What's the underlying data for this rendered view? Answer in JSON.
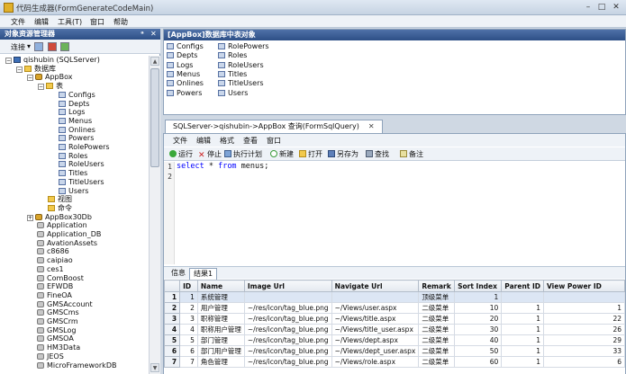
{
  "window": {
    "title": "代码生成器(FormGenerateCodeMain)",
    "minimize": "–",
    "maximize": "□",
    "close": "✕"
  },
  "menu": [
    "文件",
    "编辑",
    "工具(T)",
    "窗口",
    "帮助"
  ],
  "left_panel": {
    "title": "对象资源管理器",
    "pin": "ᵃ",
    "close": "✕",
    "toolbar": {
      "connect_label": "连接",
      "dropdown": "▾"
    },
    "tree": [
      {
        "label": "qishubin (SQLServer)",
        "level": 0,
        "icon": "server-icon",
        "expander": "−"
      },
      {
        "label": "数据库",
        "level": 1,
        "icon": "folder-icon",
        "expander": "−"
      },
      {
        "label": "AppBox",
        "level": 2,
        "icon": "database-icon",
        "expander": "−"
      },
      {
        "label": "表",
        "level": 3,
        "icon": "folder-icon",
        "expander": "−"
      },
      {
        "label": "Configs",
        "level": 4,
        "icon": "table-icon"
      },
      {
        "label": "Depts",
        "level": 4,
        "icon": "table-icon"
      },
      {
        "label": "Logs",
        "level": 4,
        "icon": "table-icon"
      },
      {
        "label": "Menus",
        "level": 4,
        "icon": "table-icon"
      },
      {
        "label": "Onlines",
        "level": 4,
        "icon": "table-icon"
      },
      {
        "label": "Powers",
        "level": 4,
        "icon": "table-icon"
      },
      {
        "label": "RolePowers",
        "level": 4,
        "icon": "table-icon"
      },
      {
        "label": "Roles",
        "level": 4,
        "icon": "table-icon"
      },
      {
        "label": "RoleUsers",
        "level": 4,
        "icon": "table-icon"
      },
      {
        "label": "Titles",
        "level": 4,
        "icon": "table-icon"
      },
      {
        "label": "TitleUsers",
        "level": 4,
        "icon": "table-icon"
      },
      {
        "label": "Users",
        "level": 4,
        "icon": "table-icon"
      },
      {
        "label": "视图",
        "level": 3,
        "icon": "folder-icon"
      },
      {
        "label": "命令",
        "level": 3,
        "icon": "folder-icon"
      },
      {
        "label": "AppBox30Db",
        "level": 2,
        "icon": "database-icon",
        "expander": "+"
      },
      {
        "label": "Application",
        "level": 2,
        "icon": "database-gray-icon"
      },
      {
        "label": "Application_DB",
        "level": 2,
        "icon": "database-gray-icon"
      },
      {
        "label": "AvationAssets",
        "level": 2,
        "icon": "database-gray-icon"
      },
      {
        "label": "c8686",
        "level": 2,
        "icon": "database-gray-icon"
      },
      {
        "label": "caipiao",
        "level": 2,
        "icon": "database-gray-icon"
      },
      {
        "label": "ces1",
        "level": 2,
        "icon": "database-gray-icon"
      },
      {
        "label": "ComBoost",
        "level": 2,
        "icon": "database-gray-icon"
      },
      {
        "label": "EFWDB",
        "level": 2,
        "icon": "database-gray-icon"
      },
      {
        "label": "FineOA",
        "level": 2,
        "icon": "database-gray-icon"
      },
      {
        "label": "GMSAccount",
        "level": 2,
        "icon": "database-gray-icon"
      },
      {
        "label": "GMSCms",
        "level": 2,
        "icon": "database-gray-icon"
      },
      {
        "label": "GMSCrm",
        "level": 2,
        "icon": "database-gray-icon"
      },
      {
        "label": "GMSLog",
        "level": 2,
        "icon": "database-gray-icon"
      },
      {
        "label": "GMSOA",
        "level": 2,
        "icon": "database-gray-icon"
      },
      {
        "label": "HM3Data",
        "level": 2,
        "icon": "database-gray-icon"
      },
      {
        "label": "JEOS",
        "level": 2,
        "icon": "database-gray-icon"
      },
      {
        "label": "MicroFrameworkDB",
        "level": 2,
        "icon": "database-gray-icon"
      }
    ]
  },
  "tables_panel": {
    "title": "[AppBox]数据库中表对象",
    "col1": [
      "Configs",
      "Depts",
      "Logs",
      "Menus",
      "Onlines",
      "Powers"
    ],
    "col2": [
      "RolePowers",
      "Roles",
      "RoleUsers",
      "Titles",
      "TitleUsers",
      "Users"
    ]
  },
  "query": {
    "tab_title": "SQLServer->qishubin->AppBox 查询(FormSqlQuery)",
    "tab_close": "✕",
    "menu": [
      "文件",
      "编辑",
      "格式",
      "查看",
      "窗口"
    ],
    "toolbar": [
      "运行",
      "停止",
      "执行计划",
      "新建",
      "打开",
      "另存为",
      "查找",
      "备注"
    ],
    "line_numbers": [
      "1",
      "2"
    ],
    "sql": {
      "kw1": "select",
      "mid": " * ",
      "kw2": "from",
      "rest": " menus;"
    },
    "result_tabs": [
      "信息",
      "结果1"
    ],
    "columns": [
      "",
      "ID",
      "Name",
      "Image Url",
      "Navigate Url",
      "Remark",
      "Sort Index",
      "Parent ID",
      "View Power ID"
    ],
    "rows": [
      [
        "1",
        "1",
        "系统管理",
        "",
        "",
        "顶级菜单",
        "1",
        "",
        ""
      ],
      [
        "2",
        "2",
        "用户管理",
        "~/res/icon/tag_blue.png",
        "~/Views/user.aspx",
        "二级菜单",
        "10",
        "1",
        "1"
      ],
      [
        "3",
        "3",
        "职称管理",
        "~/res/icon/tag_blue.png",
        "~/Views/title.aspx",
        "二级菜单",
        "20",
        "1",
        "22"
      ],
      [
        "4",
        "4",
        "职称用户管理",
        "~/res/icon/tag_blue.png",
        "~/Views/title_user.aspx",
        "二级菜单",
        "30",
        "1",
        "26"
      ],
      [
        "5",
        "5",
        "部门管理",
        "~/res/icon/tag_blue.png",
        "~/Views/dept.aspx",
        "二级菜单",
        "40",
        "1",
        "29"
      ],
      [
        "6",
        "6",
        "部门用户管理",
        "~/res/icon/tag_blue.png",
        "~/Views/dept_user.aspx",
        "二级菜单",
        "50",
        "1",
        "33"
      ],
      [
        "7",
        "7",
        "角色管理",
        "~/res/icon/tag_blue.png",
        "~/Views/role.aspx",
        "二级菜单",
        "60",
        "1",
        "6"
      ]
    ]
  }
}
